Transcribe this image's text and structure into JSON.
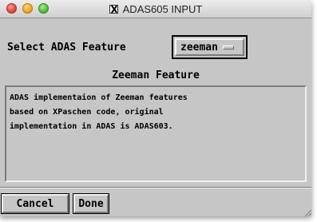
{
  "window": {
    "title": "ADAS605 INPUT"
  },
  "select": {
    "label": "Select ADAS Feature",
    "current_option": "zeeman"
  },
  "feature": {
    "title": "Zeeman Feature",
    "description": "ADAS implementaion of Zeeman features\nbased on XPaschen code, original\nimplementation in ADAS is ADAS603."
  },
  "buttons": {
    "cancel": "Cancel",
    "done": "Done"
  },
  "colors": {
    "window_bg": "#c6c6c6",
    "close": "#e0443e",
    "minimize": "#f0a51f",
    "zoom": "#4fbf3a"
  },
  "icons": {
    "title_app_icon": "x11-icon"
  }
}
